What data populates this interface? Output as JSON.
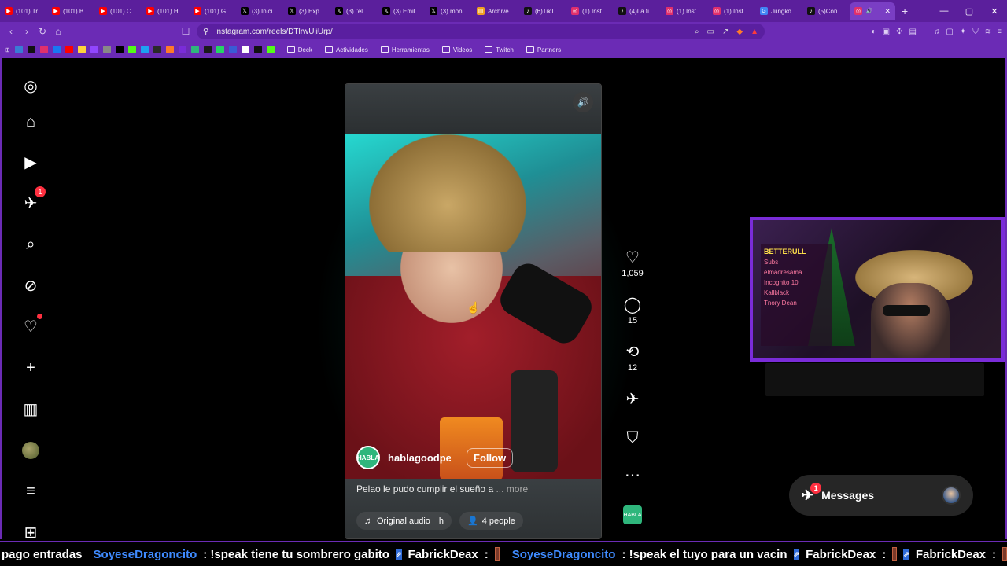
{
  "tabs": [
    {
      "label": "(101) Tr",
      "icon": "youtube-icon",
      "color": "#ff0000"
    },
    {
      "label": "(101) B",
      "icon": "youtube-icon",
      "color": "#ff0000"
    },
    {
      "label": "(101) C",
      "icon": "youtube-icon",
      "color": "#ff0000"
    },
    {
      "label": "(101) H",
      "icon": "youtube-icon",
      "color": "#ff0000"
    },
    {
      "label": "(101) G",
      "icon": "youtube-icon",
      "color": "#ff0000"
    },
    {
      "label": "(3) Inici",
      "icon": "x-icon",
      "color": "#000000"
    },
    {
      "label": "(3) Exp",
      "icon": "x-icon",
      "color": "#000000"
    },
    {
      "label": "(3) \"el",
      "icon": "x-icon",
      "color": "#000000"
    },
    {
      "label": "(3) Emil",
      "icon": "x-icon",
      "color": "#000000"
    },
    {
      "label": "(3) mon",
      "icon": "x-icon",
      "color": "#000000"
    },
    {
      "label": "Archive",
      "icon": "archive-icon",
      "color": "#f0a020"
    },
    {
      "label": "(6)TikT",
      "icon": "tiktok-icon",
      "color": "#111111"
    },
    {
      "label": "(1) Inst",
      "icon": "instagram-icon",
      "color": "#e1306c"
    },
    {
      "label": "(4)La ti",
      "icon": "tiktok-icon",
      "color": "#111111"
    },
    {
      "label": "(1) Inst",
      "icon": "instagram-icon",
      "color": "#e1306c"
    },
    {
      "label": "(1) Inst",
      "icon": "instagram-icon",
      "color": "#e1306c"
    },
    {
      "label": "Jungko",
      "icon": "google-icon",
      "color": "#4285f4"
    },
    {
      "label": "(5)Con",
      "icon": "tiktok-icon",
      "color": "#111111"
    }
  ],
  "active_tab": {
    "icon": "instagram-icon"
  },
  "address": {
    "url": "instagram.com/reels/DTlrwUjiUrp/"
  },
  "bookmarks": {
    "folders": [
      "Deck",
      "Actividades",
      "Herramientas",
      "Videos",
      "Twitch",
      "Partners"
    ]
  },
  "sidebar": {
    "notifications_badge": "1"
  },
  "reel": {
    "username": "hablagoodpe",
    "follow_label": "Follow",
    "avatar_label": "HABLA",
    "caption": "Pelao le pudo cumplir el sueño a",
    "more_label": "... more",
    "audio_label": "Original audio",
    "audio_suffix": "h",
    "people_label": "4 people"
  },
  "actions": {
    "likes": "1,059",
    "comments": "15",
    "reposts": "12"
  },
  "cam": {
    "title": "BETTERULL",
    "lines": [
      "Subs",
      "elmadresama",
      "Incognito 10",
      "Kallblack",
      "Tnory Dean"
    ]
  },
  "messages": {
    "label": "Messages",
    "badge": "1"
  },
  "ticker": {
    "t1": "pago entradas",
    "u1": "SoyeseDragoncito",
    "m1": ": !speak tiene tu sombrero gabito",
    "u2": "FabrickDeax",
    "c2": ":",
    "u3": "SoyeseDragoncito",
    "m3": ": !speak el tuyo para un vacin",
    "u4": "FabrickDeax",
    "c4": ":",
    "u5": "FabrickDeax",
    "c5": ":"
  }
}
